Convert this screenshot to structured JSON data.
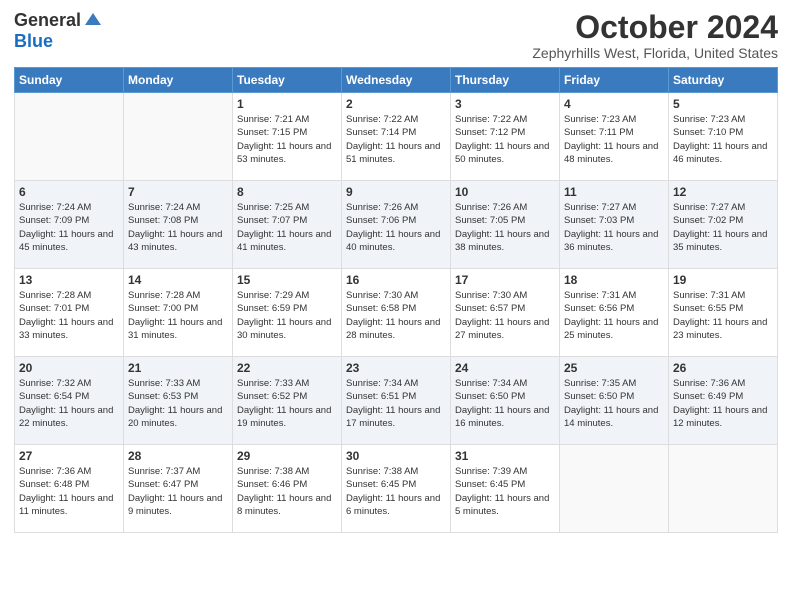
{
  "header": {
    "logo_general": "General",
    "logo_blue": "Blue",
    "title": "October 2024",
    "location": "Zephyrhills West, Florida, United States"
  },
  "weekdays": [
    "Sunday",
    "Monday",
    "Tuesday",
    "Wednesday",
    "Thursday",
    "Friday",
    "Saturday"
  ],
  "weeks": [
    [
      {
        "day": "",
        "info": ""
      },
      {
        "day": "",
        "info": ""
      },
      {
        "day": "1",
        "info": "Sunrise: 7:21 AM\nSunset: 7:15 PM\nDaylight: 11 hours and 53 minutes."
      },
      {
        "day": "2",
        "info": "Sunrise: 7:22 AM\nSunset: 7:14 PM\nDaylight: 11 hours and 51 minutes."
      },
      {
        "day": "3",
        "info": "Sunrise: 7:22 AM\nSunset: 7:12 PM\nDaylight: 11 hours and 50 minutes."
      },
      {
        "day": "4",
        "info": "Sunrise: 7:23 AM\nSunset: 7:11 PM\nDaylight: 11 hours and 48 minutes."
      },
      {
        "day": "5",
        "info": "Sunrise: 7:23 AM\nSunset: 7:10 PM\nDaylight: 11 hours and 46 minutes."
      }
    ],
    [
      {
        "day": "6",
        "info": "Sunrise: 7:24 AM\nSunset: 7:09 PM\nDaylight: 11 hours and 45 minutes."
      },
      {
        "day": "7",
        "info": "Sunrise: 7:24 AM\nSunset: 7:08 PM\nDaylight: 11 hours and 43 minutes."
      },
      {
        "day": "8",
        "info": "Sunrise: 7:25 AM\nSunset: 7:07 PM\nDaylight: 11 hours and 41 minutes."
      },
      {
        "day": "9",
        "info": "Sunrise: 7:26 AM\nSunset: 7:06 PM\nDaylight: 11 hours and 40 minutes."
      },
      {
        "day": "10",
        "info": "Sunrise: 7:26 AM\nSunset: 7:05 PM\nDaylight: 11 hours and 38 minutes."
      },
      {
        "day": "11",
        "info": "Sunrise: 7:27 AM\nSunset: 7:03 PM\nDaylight: 11 hours and 36 minutes."
      },
      {
        "day": "12",
        "info": "Sunrise: 7:27 AM\nSunset: 7:02 PM\nDaylight: 11 hours and 35 minutes."
      }
    ],
    [
      {
        "day": "13",
        "info": "Sunrise: 7:28 AM\nSunset: 7:01 PM\nDaylight: 11 hours and 33 minutes."
      },
      {
        "day": "14",
        "info": "Sunrise: 7:28 AM\nSunset: 7:00 PM\nDaylight: 11 hours and 31 minutes."
      },
      {
        "day": "15",
        "info": "Sunrise: 7:29 AM\nSunset: 6:59 PM\nDaylight: 11 hours and 30 minutes."
      },
      {
        "day": "16",
        "info": "Sunrise: 7:30 AM\nSunset: 6:58 PM\nDaylight: 11 hours and 28 minutes."
      },
      {
        "day": "17",
        "info": "Sunrise: 7:30 AM\nSunset: 6:57 PM\nDaylight: 11 hours and 27 minutes."
      },
      {
        "day": "18",
        "info": "Sunrise: 7:31 AM\nSunset: 6:56 PM\nDaylight: 11 hours and 25 minutes."
      },
      {
        "day": "19",
        "info": "Sunrise: 7:31 AM\nSunset: 6:55 PM\nDaylight: 11 hours and 23 minutes."
      }
    ],
    [
      {
        "day": "20",
        "info": "Sunrise: 7:32 AM\nSunset: 6:54 PM\nDaylight: 11 hours and 22 minutes."
      },
      {
        "day": "21",
        "info": "Sunrise: 7:33 AM\nSunset: 6:53 PM\nDaylight: 11 hours and 20 minutes."
      },
      {
        "day": "22",
        "info": "Sunrise: 7:33 AM\nSunset: 6:52 PM\nDaylight: 11 hours and 19 minutes."
      },
      {
        "day": "23",
        "info": "Sunrise: 7:34 AM\nSunset: 6:51 PM\nDaylight: 11 hours and 17 minutes."
      },
      {
        "day": "24",
        "info": "Sunrise: 7:34 AM\nSunset: 6:50 PM\nDaylight: 11 hours and 16 minutes."
      },
      {
        "day": "25",
        "info": "Sunrise: 7:35 AM\nSunset: 6:50 PM\nDaylight: 11 hours and 14 minutes."
      },
      {
        "day": "26",
        "info": "Sunrise: 7:36 AM\nSunset: 6:49 PM\nDaylight: 11 hours and 12 minutes."
      }
    ],
    [
      {
        "day": "27",
        "info": "Sunrise: 7:36 AM\nSunset: 6:48 PM\nDaylight: 11 hours and 11 minutes."
      },
      {
        "day": "28",
        "info": "Sunrise: 7:37 AM\nSunset: 6:47 PM\nDaylight: 11 hours and 9 minutes."
      },
      {
        "day": "29",
        "info": "Sunrise: 7:38 AM\nSunset: 6:46 PM\nDaylight: 11 hours and 8 minutes."
      },
      {
        "day": "30",
        "info": "Sunrise: 7:38 AM\nSunset: 6:45 PM\nDaylight: 11 hours and 6 minutes."
      },
      {
        "day": "31",
        "info": "Sunrise: 7:39 AM\nSunset: 6:45 PM\nDaylight: 11 hours and 5 minutes."
      },
      {
        "day": "",
        "info": ""
      },
      {
        "day": "",
        "info": ""
      }
    ]
  ]
}
